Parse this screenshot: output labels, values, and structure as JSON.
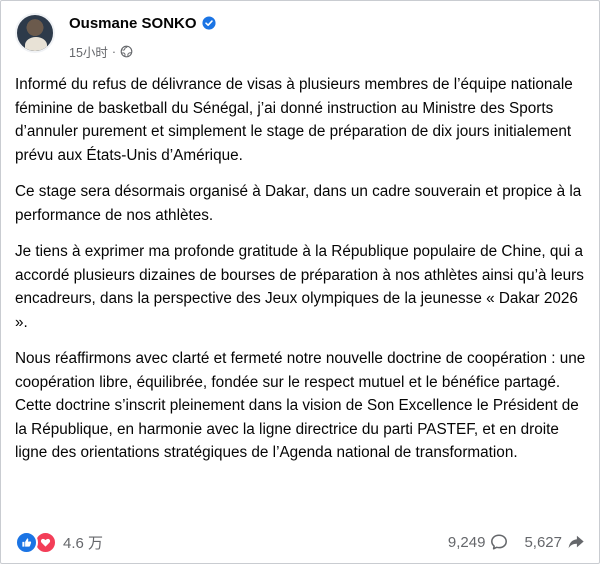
{
  "post": {
    "author": "Ousmane SONKO",
    "time": "15小时",
    "separator": "·",
    "paragraphs": [
      "Informé du refus de délivrance de visas à plusieurs membres de l’équipe nationale féminine de basketball du Sénégal, j’ai donné instruction au Ministre des Sports d’annuler purement et simplement le stage de préparation de dix jours initialement prévu aux États-Unis d’Amérique.",
      "Ce stage sera désormais organisé à Dakar, dans un cadre souverain et propice à la performance de nos athlètes.",
      "Je tiens à exprimer ma profonde gratitude à la République populaire de Chine, qui a accordé plusieurs dizaines de bourses de préparation à nos athlètes ainsi qu’à leurs encadreurs, dans la perspective des Jeux olympiques de la jeunesse « Dakar 2026 ».",
      "Nous réaffirmons avec clarté et fermeté notre nouvelle doctrine de coopération : une coopération libre, équilibrée, fondée sur le respect mutuel et le bénéfice partagé. Cette doctrine s’inscrit pleinement dans la vision de Son Excellence le Président de la République, en harmonie avec la ligne directrice du parti PASTEF, et en droite ligne des orientations stratégiques de l’Agenda national de transformation."
    ]
  },
  "footer": {
    "reactions_count": "4.6 万",
    "comments_count": "9,249",
    "shares_count": "5,627"
  },
  "icons": {
    "verified": "verified-badge-icon",
    "audience": "globe-icon",
    "like": "like-icon",
    "love": "love-icon",
    "comment": "comment-icon",
    "share": "share-icon"
  },
  "colors": {
    "verified": "#1b74e4",
    "like": "#1b74e4",
    "love": "#f33e58",
    "secondary_text": "#65676b"
  }
}
